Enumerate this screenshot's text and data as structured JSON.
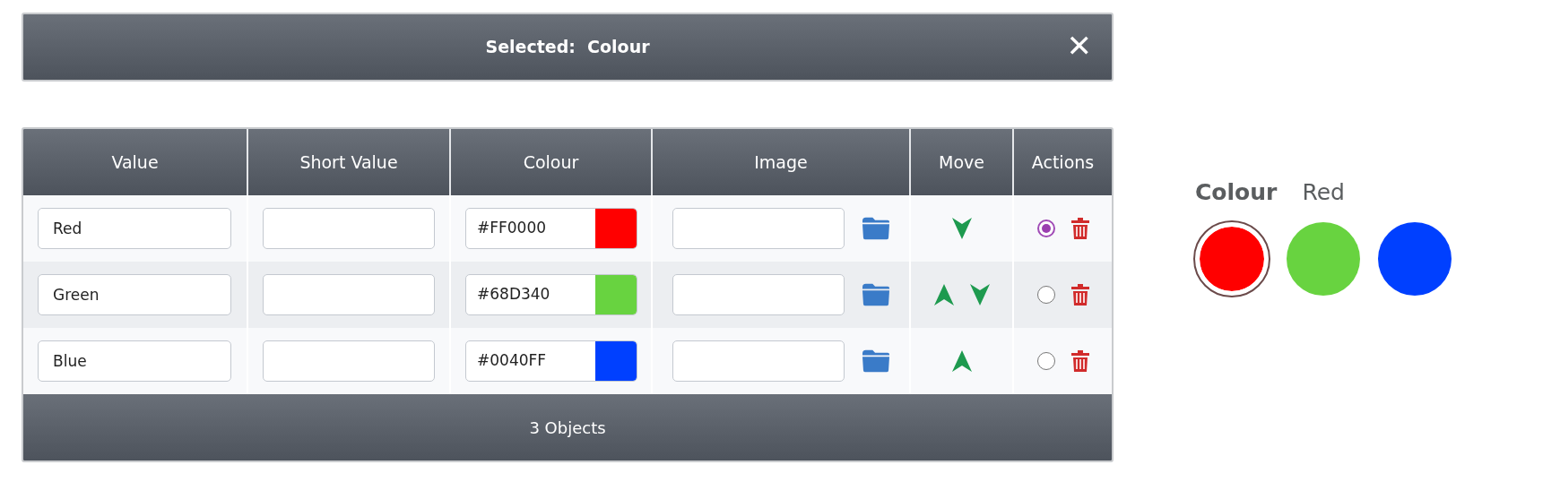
{
  "selected_bar": {
    "text": "Selected:  Colour",
    "close": "✕"
  },
  "table": {
    "columns": [
      "Value",
      "Short Value",
      "Colour",
      "Image",
      "Move",
      "Actions"
    ],
    "rows": [
      {
        "value": "Red",
        "colour": "#FF0000",
        "color": "#ff0000",
        "move_up": false,
        "move_down": true,
        "selected": true
      },
      {
        "value": "Green",
        "colour": "#68D340",
        "color": "#68d340",
        "move_up": true,
        "move_down": true,
        "selected": false
      },
      {
        "value": "Blue",
        "colour": "#0040FF",
        "color": "#0040ff",
        "move_up": true,
        "move_down": false,
        "selected": false
      }
    ],
    "footer": "3 Objects"
  },
  "preview": {
    "label": "Colour",
    "value": "Red",
    "swatches": [
      {
        "color": "#ff0000",
        "selected": true
      },
      {
        "color": "#68d340",
        "selected": false
      },
      {
        "color": "#0040ff",
        "selected": false
      }
    ]
  }
}
